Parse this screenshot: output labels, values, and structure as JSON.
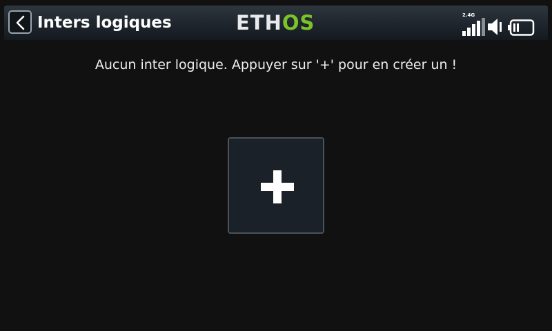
{
  "header": {
    "title": "Inters logiques",
    "back_icon": "chevron-left-icon",
    "brand": {
      "part1": "ETH",
      "part2": "OS",
      "color_main": "#e8eaed",
      "color_accent": "#7cc22a"
    },
    "status": {
      "rf_band": "2.4G",
      "signal_icon": "signal-bars-icon",
      "speaker_icon": "speaker-icon",
      "battery_icon": "battery-icon"
    }
  },
  "main": {
    "empty_message": "Aucun inter logique. Appuyer sur '+' pour en créer un !",
    "add_icon": "plus-icon"
  }
}
